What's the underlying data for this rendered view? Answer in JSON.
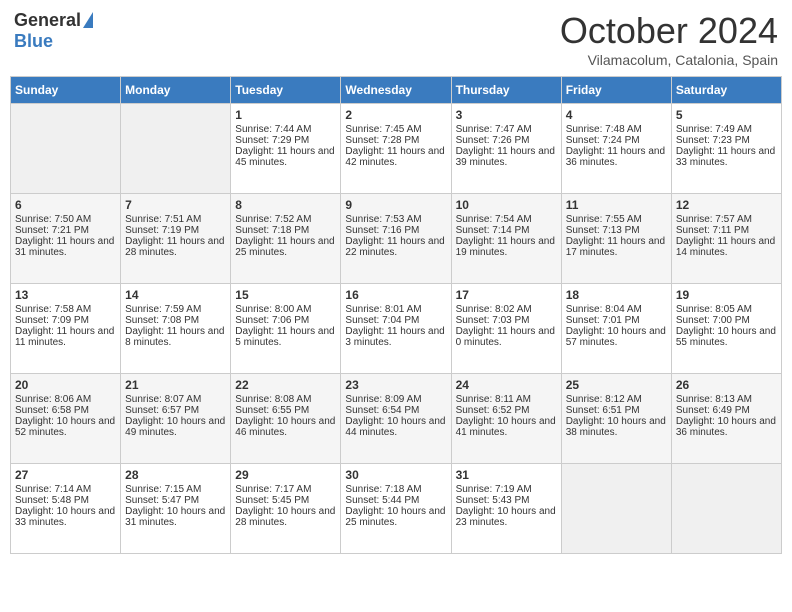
{
  "header": {
    "logo_general": "General",
    "logo_blue": "Blue",
    "title": "October 2024",
    "location": "Vilamacolum, Catalonia, Spain"
  },
  "days_header": [
    "Sunday",
    "Monday",
    "Tuesday",
    "Wednesday",
    "Thursday",
    "Friday",
    "Saturday"
  ],
  "weeks": [
    [
      {
        "day": "",
        "empty": true
      },
      {
        "day": "",
        "empty": true
      },
      {
        "day": "1",
        "sunrise": "Sunrise: 7:44 AM",
        "sunset": "Sunset: 7:29 PM",
        "daylight": "Daylight: 11 hours and 45 minutes."
      },
      {
        "day": "2",
        "sunrise": "Sunrise: 7:45 AM",
        "sunset": "Sunset: 7:28 PM",
        "daylight": "Daylight: 11 hours and 42 minutes."
      },
      {
        "day": "3",
        "sunrise": "Sunrise: 7:47 AM",
        "sunset": "Sunset: 7:26 PM",
        "daylight": "Daylight: 11 hours and 39 minutes."
      },
      {
        "day": "4",
        "sunrise": "Sunrise: 7:48 AM",
        "sunset": "Sunset: 7:24 PM",
        "daylight": "Daylight: 11 hours and 36 minutes."
      },
      {
        "day": "5",
        "sunrise": "Sunrise: 7:49 AM",
        "sunset": "Sunset: 7:23 PM",
        "daylight": "Daylight: 11 hours and 33 minutes."
      }
    ],
    [
      {
        "day": "6",
        "sunrise": "Sunrise: 7:50 AM",
        "sunset": "Sunset: 7:21 PM",
        "daylight": "Daylight: 11 hours and 31 minutes."
      },
      {
        "day": "7",
        "sunrise": "Sunrise: 7:51 AM",
        "sunset": "Sunset: 7:19 PM",
        "daylight": "Daylight: 11 hours and 28 minutes."
      },
      {
        "day": "8",
        "sunrise": "Sunrise: 7:52 AM",
        "sunset": "Sunset: 7:18 PM",
        "daylight": "Daylight: 11 hours and 25 minutes."
      },
      {
        "day": "9",
        "sunrise": "Sunrise: 7:53 AM",
        "sunset": "Sunset: 7:16 PM",
        "daylight": "Daylight: 11 hours and 22 minutes."
      },
      {
        "day": "10",
        "sunrise": "Sunrise: 7:54 AM",
        "sunset": "Sunset: 7:14 PM",
        "daylight": "Daylight: 11 hours and 19 minutes."
      },
      {
        "day": "11",
        "sunrise": "Sunrise: 7:55 AM",
        "sunset": "Sunset: 7:13 PM",
        "daylight": "Daylight: 11 hours and 17 minutes."
      },
      {
        "day": "12",
        "sunrise": "Sunrise: 7:57 AM",
        "sunset": "Sunset: 7:11 PM",
        "daylight": "Daylight: 11 hours and 14 minutes."
      }
    ],
    [
      {
        "day": "13",
        "sunrise": "Sunrise: 7:58 AM",
        "sunset": "Sunset: 7:09 PM",
        "daylight": "Daylight: 11 hours and 11 minutes."
      },
      {
        "day": "14",
        "sunrise": "Sunrise: 7:59 AM",
        "sunset": "Sunset: 7:08 PM",
        "daylight": "Daylight: 11 hours and 8 minutes."
      },
      {
        "day": "15",
        "sunrise": "Sunrise: 8:00 AM",
        "sunset": "Sunset: 7:06 PM",
        "daylight": "Daylight: 11 hours and 5 minutes."
      },
      {
        "day": "16",
        "sunrise": "Sunrise: 8:01 AM",
        "sunset": "Sunset: 7:04 PM",
        "daylight": "Daylight: 11 hours and 3 minutes."
      },
      {
        "day": "17",
        "sunrise": "Sunrise: 8:02 AM",
        "sunset": "Sunset: 7:03 PM",
        "daylight": "Daylight: 11 hours and 0 minutes."
      },
      {
        "day": "18",
        "sunrise": "Sunrise: 8:04 AM",
        "sunset": "Sunset: 7:01 PM",
        "daylight": "Daylight: 10 hours and 57 minutes."
      },
      {
        "day": "19",
        "sunrise": "Sunrise: 8:05 AM",
        "sunset": "Sunset: 7:00 PM",
        "daylight": "Daylight: 10 hours and 55 minutes."
      }
    ],
    [
      {
        "day": "20",
        "sunrise": "Sunrise: 8:06 AM",
        "sunset": "Sunset: 6:58 PM",
        "daylight": "Daylight: 10 hours and 52 minutes."
      },
      {
        "day": "21",
        "sunrise": "Sunrise: 8:07 AM",
        "sunset": "Sunset: 6:57 PM",
        "daylight": "Daylight: 10 hours and 49 minutes."
      },
      {
        "day": "22",
        "sunrise": "Sunrise: 8:08 AM",
        "sunset": "Sunset: 6:55 PM",
        "daylight": "Daylight: 10 hours and 46 minutes."
      },
      {
        "day": "23",
        "sunrise": "Sunrise: 8:09 AM",
        "sunset": "Sunset: 6:54 PM",
        "daylight": "Daylight: 10 hours and 44 minutes."
      },
      {
        "day": "24",
        "sunrise": "Sunrise: 8:11 AM",
        "sunset": "Sunset: 6:52 PM",
        "daylight": "Daylight: 10 hours and 41 minutes."
      },
      {
        "day": "25",
        "sunrise": "Sunrise: 8:12 AM",
        "sunset": "Sunset: 6:51 PM",
        "daylight": "Daylight: 10 hours and 38 minutes."
      },
      {
        "day": "26",
        "sunrise": "Sunrise: 8:13 AM",
        "sunset": "Sunset: 6:49 PM",
        "daylight": "Daylight: 10 hours and 36 minutes."
      }
    ],
    [
      {
        "day": "27",
        "sunrise": "Sunrise: 7:14 AM",
        "sunset": "Sunset: 5:48 PM",
        "daylight": "Daylight: 10 hours and 33 minutes."
      },
      {
        "day": "28",
        "sunrise": "Sunrise: 7:15 AM",
        "sunset": "Sunset: 5:47 PM",
        "daylight": "Daylight: 10 hours and 31 minutes."
      },
      {
        "day": "29",
        "sunrise": "Sunrise: 7:17 AM",
        "sunset": "Sunset: 5:45 PM",
        "daylight": "Daylight: 10 hours and 28 minutes."
      },
      {
        "day": "30",
        "sunrise": "Sunrise: 7:18 AM",
        "sunset": "Sunset: 5:44 PM",
        "daylight": "Daylight: 10 hours and 25 minutes."
      },
      {
        "day": "31",
        "sunrise": "Sunrise: 7:19 AM",
        "sunset": "Sunset: 5:43 PM",
        "daylight": "Daylight: 10 hours and 23 minutes."
      },
      {
        "day": "",
        "empty": true
      },
      {
        "day": "",
        "empty": true
      }
    ]
  ]
}
